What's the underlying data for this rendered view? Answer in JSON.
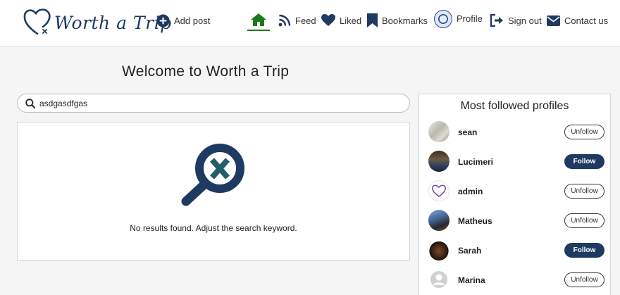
{
  "brand": {
    "name": "Worth a Trip",
    "color": "#1f3a60"
  },
  "nav": {
    "add_post": "Add post",
    "feed": "Feed",
    "liked": "Liked",
    "bookmarks": "Bookmarks",
    "profile": "Profile",
    "sign_out": "Sign out",
    "contact": "Contact us",
    "active_color": "#1d7a1d"
  },
  "main": {
    "welcome": "Welcome to Worth a Trip",
    "search_value": "asdgasdfgas",
    "no_results": "No results found. Adjust the search keyword."
  },
  "sidebar": {
    "title": "Most followed profiles",
    "profiles": [
      {
        "name": "sean",
        "action": "Unfollow"
      },
      {
        "name": "Lucimeri",
        "action": "Follow"
      },
      {
        "name": "admin",
        "action": "Unfollow"
      },
      {
        "name": "Matheus",
        "action": "Unfollow"
      },
      {
        "name": "Sarah",
        "action": "Follow"
      },
      {
        "name": "Marina",
        "action": "Unfollow"
      }
    ]
  }
}
